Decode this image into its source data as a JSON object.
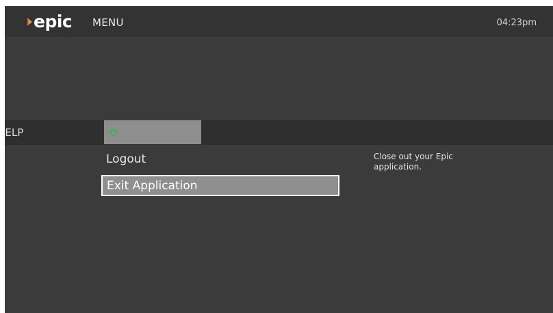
{
  "header": {
    "logo_text": "epic",
    "title": "MENU",
    "time": "04:23pm"
  },
  "nav": {
    "help_label": "IELP",
    "power_icon": "power-icon",
    "power_icon_color": "#3cb34a"
  },
  "menu": {
    "items": [
      {
        "label": "Logout",
        "selected": false
      },
      {
        "label": "Exit Application",
        "selected": true
      }
    ]
  },
  "description": "Close out your Epic application."
}
